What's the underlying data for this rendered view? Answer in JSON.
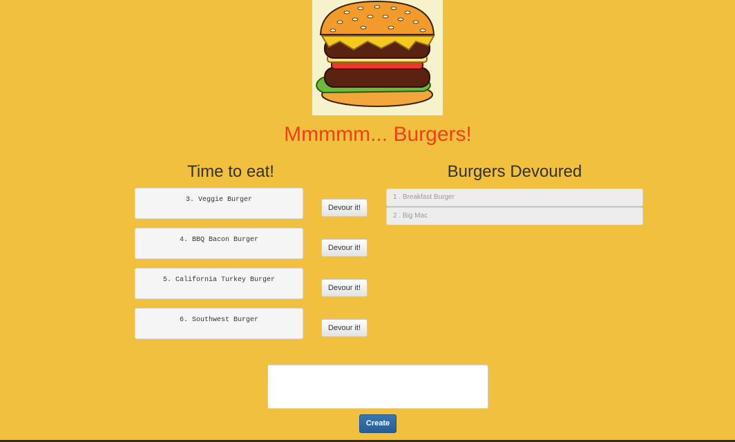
{
  "header": {
    "image_alt": "burger-illustration",
    "title": "Mmmmm... Burgers!"
  },
  "colors": {
    "background": "#f2c03f",
    "title": "#f0401b",
    "create_button": "#2f6ca8"
  },
  "to_eat": {
    "heading": "Time to eat!",
    "devour_label": "Devour it!",
    "items": [
      {
        "label": "3. Veggie Burger"
      },
      {
        "label": "4. BBQ Bacon Burger"
      },
      {
        "label": "5. California Turkey Burger"
      },
      {
        "label": "6. Southwest Burger"
      }
    ]
  },
  "devoured": {
    "heading": "Burgers Devoured",
    "items": [
      {
        "label": "1 . Breakfast Burger"
      },
      {
        "label": "2 . Big Mac"
      }
    ]
  },
  "create_form": {
    "input_value": "",
    "placeholder": "",
    "button_label": "Create"
  }
}
